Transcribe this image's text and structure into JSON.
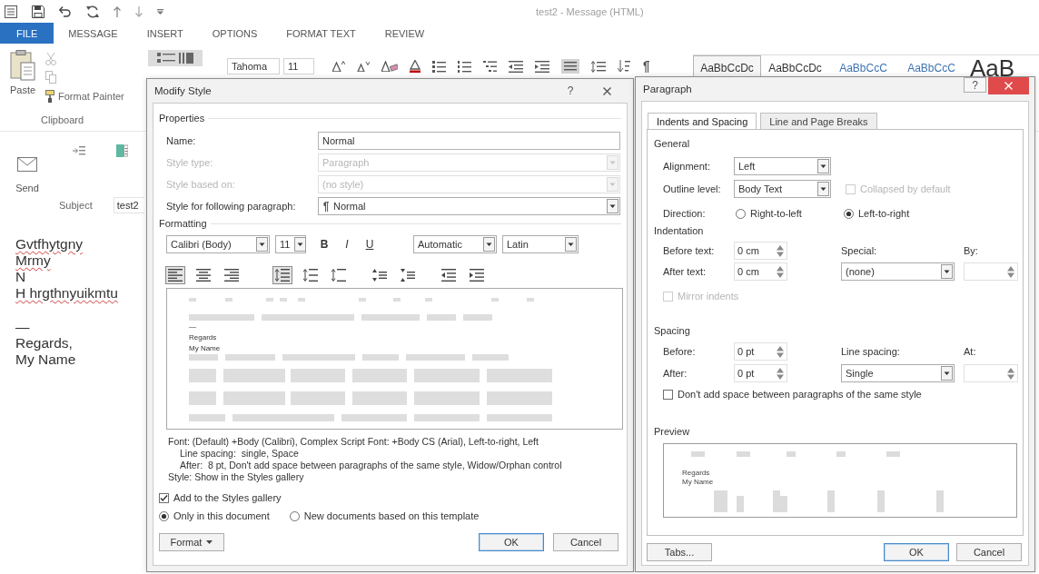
{
  "window": {
    "title": "test2 - Message (HTML)"
  },
  "ribbon_tabs": [
    {
      "label": "FILE",
      "selected": true
    },
    {
      "label": "MESSAGE",
      "selected": false
    },
    {
      "label": "INSERT",
      "selected": false
    },
    {
      "label": "OPTIONS",
      "selected": false
    },
    {
      "label": "FORMAT TEXT",
      "selected": false
    },
    {
      "label": "REVIEW",
      "selected": false
    }
  ],
  "clipboard": {
    "paste": "Paste",
    "format_painter": "Format Painter",
    "group": "Clipboard"
  },
  "font_box": {
    "font": "Tahoma",
    "size": "11"
  },
  "style_gallery": [
    {
      "sample": "AaBbCcDc",
      "kind": "normal",
      "selected": true
    },
    {
      "sample": "AaBbCcDc",
      "kind": "normal",
      "selected": false
    },
    {
      "sample": "AaBbCcC",
      "kind": "heading",
      "selected": false
    },
    {
      "sample": "AaBbCcC",
      "kind": "heading",
      "selected": false
    },
    {
      "sample": "AaB",
      "kind": "title",
      "selected": false
    }
  ],
  "message_header": {
    "send": "Send",
    "subject_label": "Subject",
    "subject": "test2"
  },
  "body": [
    {
      "lines": [
        {
          "text": "Gvtfhytgny",
          "misspelled": true
        },
        {
          "text": "Mrmy",
          "misspelled": true
        },
        {
          "text": "N",
          "misspelled": false
        },
        {
          "text": "H hrgthnyuikmtu",
          "misspelled": true
        }
      ]
    },
    {
      "lines": [
        {
          "text": "—",
          "misspelled": false
        },
        {
          "text": "Regards,",
          "misspelled": false
        },
        {
          "text": "My Name",
          "misspelled": false
        }
      ]
    }
  ],
  "modify_style": {
    "title": "Modify Style",
    "help": "?",
    "properties_heading": "Properties",
    "properties": [
      {
        "label": "Name:",
        "value": "Normal",
        "kind": "text",
        "disabled": false
      },
      {
        "label": "Style type:",
        "value": "Paragraph",
        "kind": "dropdown",
        "disabled": true
      },
      {
        "label": "Style based on:",
        "value": "(no style)",
        "kind": "dropdown",
        "disabled": true
      },
      {
        "label": "Style for following paragraph:",
        "value": "Normal",
        "kind": "style",
        "disabled": false
      }
    ],
    "formatting_heading": "Formatting",
    "font": "Calibri (Body)",
    "size": "11",
    "toggles": [
      {
        "label": "B",
        "kind": "bold",
        "selected": false
      },
      {
        "label": "I",
        "kind": "italic",
        "selected": false
      },
      {
        "label": "U",
        "kind": "underline",
        "selected": false
      }
    ],
    "font_color": "Automatic",
    "script": "Latin",
    "tool_groups": [
      {
        "tools": [
          {
            "kind": "align-left",
            "selected": true
          },
          {
            "kind": "align-center",
            "selected": false
          },
          {
            "kind": "align-right",
            "selected": false
          }
        ]
      },
      {
        "tools": [
          {
            "kind": "spacing-single",
            "selected": true
          },
          {
            "kind": "spacing-onehalf",
            "selected": false
          },
          {
            "kind": "spacing-double",
            "selected": false
          }
        ]
      },
      {
        "tools": [
          {
            "kind": "space-increase",
            "selected": false
          },
          {
            "kind": "space-decrease",
            "selected": false
          }
        ]
      },
      {
        "tools": [
          {
            "kind": "indent-decrease",
            "selected": false
          },
          {
            "kind": "indent-increase",
            "selected": false
          }
        ]
      }
    ],
    "preview_lines": [
      "—",
      "Regards",
      "My Name"
    ],
    "description": [
      {
        "text": "Font: (Default) +Body (Calibri), Complex Script Font: +Body CS (Arial), Left-to-right, Left",
        "kind": "first"
      },
      {
        "text": "Line spacing:  single, Space",
        "kind": "continuation"
      },
      {
        "text": "After:  8 pt, Don't add space between paragraphs of the same style, Widow/Orphan control",
        "kind": "continuation"
      },
      {
        "text": "Style: Show in the Styles gallery",
        "kind": "first"
      }
    ],
    "add_to_gallery": {
      "label": "Add to the Styles gallery",
      "checked": true
    },
    "scope": [
      {
        "label": "Only in this document",
        "selected": true
      },
      {
        "label": "New documents based on this template",
        "selected": false
      }
    ],
    "buttons": [
      {
        "label": "Format",
        "kind": "menu"
      },
      {
        "label": "OK",
        "kind": "default"
      },
      {
        "label": "Cancel",
        "kind": "plain"
      }
    ]
  },
  "paragraph": {
    "title": "Paragraph",
    "help": "?",
    "tabs": [
      {
        "label": "Indents and Spacing",
        "selected": true
      },
      {
        "label": "Line and Page Breaks",
        "selected": false
      }
    ],
    "general_heading": "General",
    "alignment": {
      "label": "Alignment:",
      "value": "Left"
    },
    "outline_level": {
      "label": "Outline level:",
      "value": "Body Text"
    },
    "collapsed": {
      "label": "Collapsed by default",
      "checked": false,
      "disabled": true
    },
    "direction": {
      "label": "Direction:",
      "options": [
        {
          "label": "Right-to-left",
          "selected": false
        },
        {
          "label": "Left-to-right",
          "selected": true
        }
      ]
    },
    "indentation_heading": "Indentation",
    "before_text": {
      "label": "Before text:",
      "value": "0 cm"
    },
    "after_text": {
      "label": "After text:",
      "value": "0 cm"
    },
    "special": {
      "label": "Special:",
      "value": "(none)"
    },
    "by": {
      "label": "By:"
    },
    "mirror_indents": {
      "label": "Mirror indents",
      "checked": false,
      "disabled": true
    },
    "spacing_heading": "Spacing",
    "before": {
      "label": "Before:",
      "value": "0 pt"
    },
    "after": {
      "label": "After:",
      "value": "0 pt"
    },
    "line_spacing": {
      "label": "Line spacing:",
      "value": "Single"
    },
    "at": {
      "label": "At:"
    },
    "dont_add_space": {
      "label": "Don't add space between paragraphs of the same style",
      "checked": false
    },
    "preview_heading": "Preview",
    "preview_lines": [
      "Regards",
      "My Name"
    ],
    "buttons": [
      {
        "label": "Tabs...",
        "kind": "plain"
      },
      {
        "label": "OK",
        "kind": "default"
      },
      {
        "label": "Cancel",
        "kind": "plain"
      }
    ]
  }
}
